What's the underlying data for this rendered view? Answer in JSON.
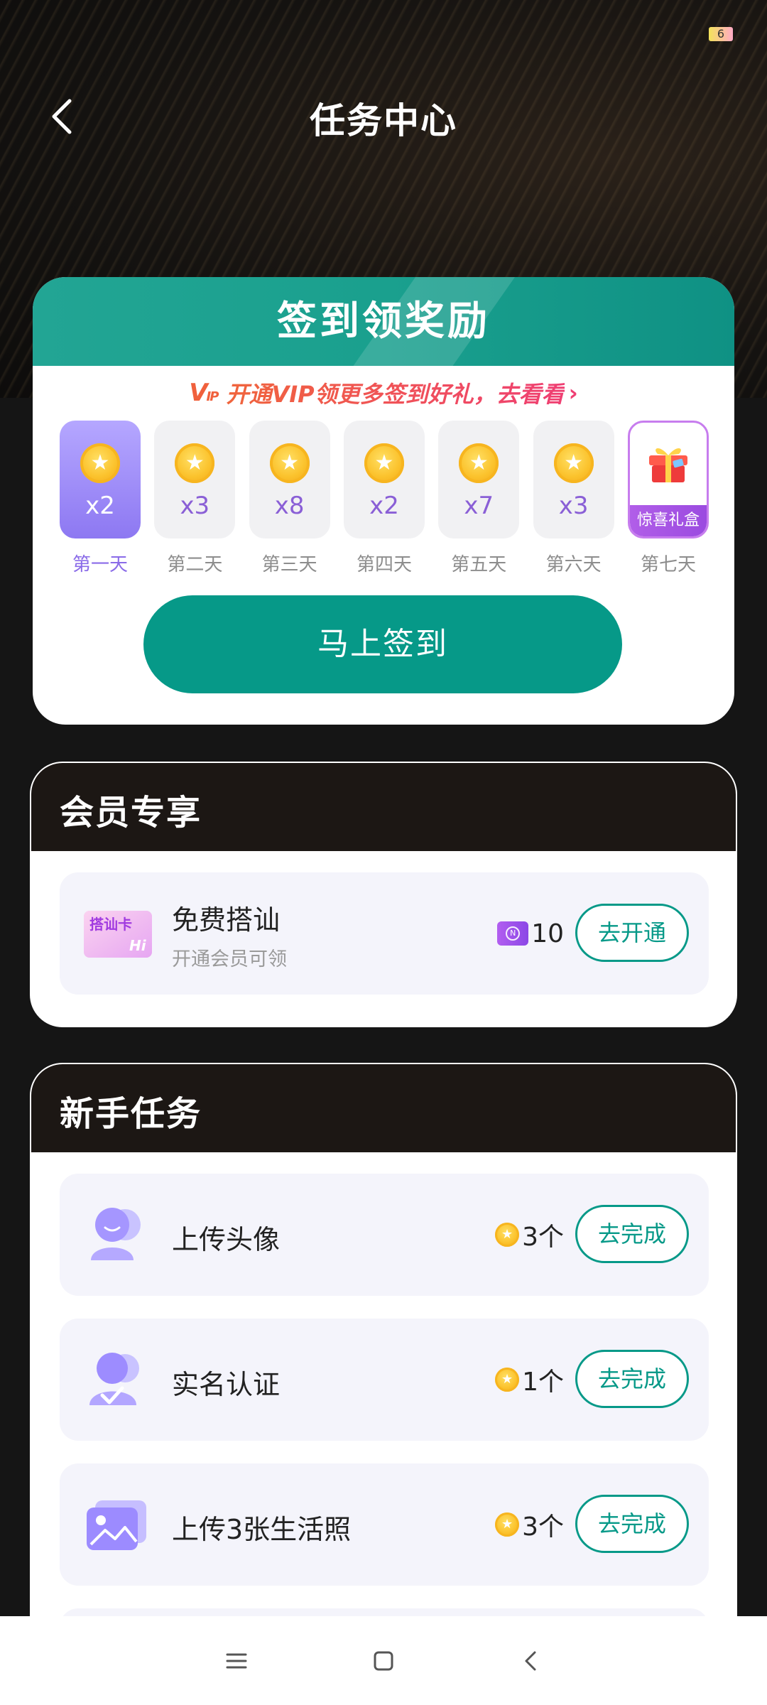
{
  "header": {
    "title": "任务中心"
  },
  "checkin": {
    "title": "签到领奖励",
    "vip_logo": "V",
    "vip_logo_small": "IP",
    "vip_promo": "开通VIP领更多签到好礼，去看看",
    "vip_arrow": "›",
    "days": [
      {
        "label": "第一天",
        "mult": "x2",
        "active": true
      },
      {
        "label": "第二天",
        "mult": "x3",
        "active": false
      },
      {
        "label": "第三天",
        "mult": "x8",
        "active": false
      },
      {
        "label": "第四天",
        "mult": "x2",
        "active": false
      },
      {
        "label": "第五天",
        "mult": "x7",
        "active": false
      },
      {
        "label": "第六天",
        "mult": "x3",
        "active": false
      },
      {
        "label": "第七天",
        "gift_label": "惊喜礼盒",
        "active": false
      }
    ],
    "signin_button": "马上签到"
  },
  "vip_section": {
    "title": "会员专享",
    "task": {
      "name": "免费搭讪",
      "subtitle": "开通会员可领",
      "card_text": "搭讪卡",
      "card_hi": "Hi",
      "reward": "10",
      "button": "去开通"
    }
  },
  "newbie_section": {
    "title": "新手任务",
    "tasks": [
      {
        "name": "上传头像",
        "reward": "3个",
        "button": "去完成"
      },
      {
        "name": "实名认证",
        "reward": "1个",
        "button": "去完成"
      },
      {
        "name": "上传3张生活照",
        "reward": "3个",
        "button": "去完成"
      }
    ]
  },
  "colors": {
    "accent": "#069988",
    "active_day": "#8d78f2",
    "coin": "#fbc22c"
  }
}
